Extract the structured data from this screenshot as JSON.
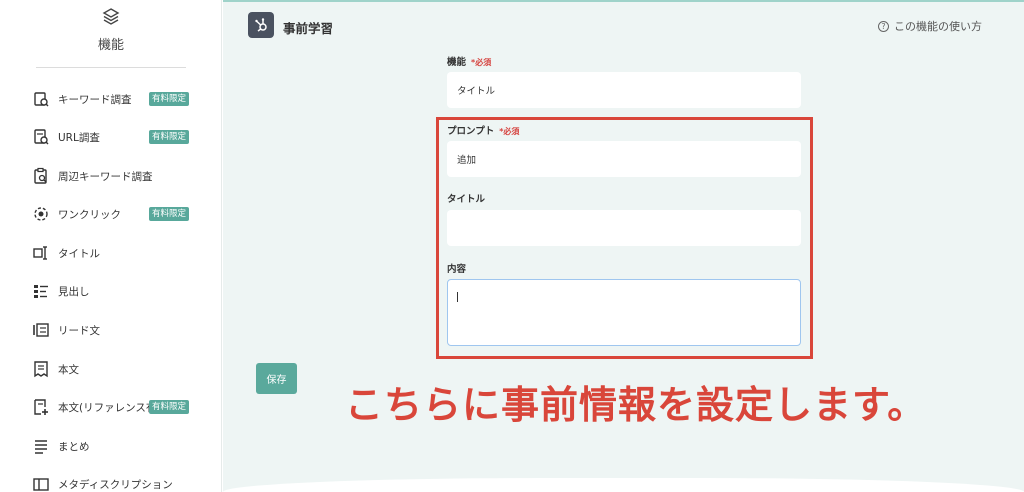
{
  "sidebar": {
    "title": "機能",
    "items": [
      {
        "label": "キーワード調査",
        "badge": "有料限定",
        "icon": "keyword-search-icon"
      },
      {
        "label": "URL調査",
        "badge": "有料限定",
        "icon": "url-search-icon"
      },
      {
        "label": "周辺キーワード調査",
        "badge": "",
        "icon": "clipboard-search-icon"
      },
      {
        "label": "ワンクリック",
        "badge": "有料限定",
        "icon": "one-click-icon"
      },
      {
        "label": "タイトル",
        "badge": "",
        "icon": "title-icon"
      },
      {
        "label": "見出し",
        "badge": "",
        "icon": "heading-icon"
      },
      {
        "label": "リード文",
        "badge": "",
        "icon": "lead-text-icon"
      },
      {
        "label": "本文",
        "badge": "",
        "icon": "body-text-icon"
      },
      {
        "label": "本文(リファレンス有)",
        "badge": "有料限定",
        "icon": "body-reference-icon"
      },
      {
        "label": "まとめ",
        "badge": "",
        "icon": "summary-icon"
      },
      {
        "label": "メタディスクリプション",
        "badge": "",
        "icon": "meta-description-icon"
      }
    ]
  },
  "header": {
    "title": "事前学習",
    "help_label": "この機能の使い方",
    "help_icon": "?"
  },
  "form": {
    "function_label": "機能",
    "required_text": "*必須",
    "function_value": "タイトル",
    "prompt_label": "プロンプト",
    "prompt_value": "追加",
    "title_label": "タイトル",
    "title_value": "",
    "content_label": "内容",
    "content_value": "",
    "save_label": "保存"
  },
  "annotation": {
    "text": "こちらに事前情報を設定します。",
    "color": "#d9463a"
  },
  "colors": {
    "accent": "#5aa99c",
    "main_bg": "#eef5f4",
    "highlight": "#d9463a"
  }
}
